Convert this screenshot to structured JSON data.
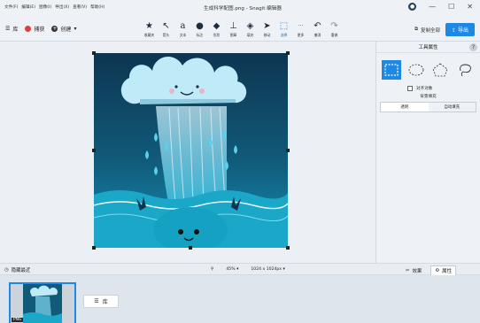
{
  "window": {
    "title": "生成科学配图.png - Snagit 编辑器",
    "menu": [
      "文件(F)",
      "编辑(E)",
      "图像(I)",
      "导出(X)",
      "查看(V)",
      "帮助(H)"
    ],
    "controls": [
      "—",
      "☐",
      "✕"
    ]
  },
  "toolbar": {
    "library": "库",
    "capture": "捕获",
    "create": "创建",
    "create_caret": "▾",
    "tools": [
      {
        "icon": "star-icon",
        "label": "收藏夹"
      },
      {
        "icon": "arrow-icon",
        "label": "箭头"
      },
      {
        "icon": "text-icon",
        "label": "文本"
      },
      {
        "icon": "callout-icon",
        "label": "标注"
      },
      {
        "icon": "shape-icon",
        "label": "形状"
      },
      {
        "icon": "stamp-icon",
        "label": "图章"
      },
      {
        "icon": "fill-icon",
        "label": "填充"
      },
      {
        "icon": "move-icon",
        "label": "移动"
      },
      {
        "icon": "selection-icon",
        "label": "选择"
      },
      {
        "icon": "more-icon",
        "label": "更多"
      },
      {
        "icon": "undo-icon",
        "label": "撤消"
      },
      {
        "icon": "redo-icon",
        "label": "重做"
      }
    ],
    "copy_all": "复制全部",
    "export": "导出"
  },
  "props": {
    "title": "工具属性",
    "help": "?",
    "align_objects": "对齐对象",
    "background_fill": "背景填充",
    "fill_options": [
      "透明",
      "自动填充"
    ]
  },
  "status": {
    "hide_recent": "隐藏最近",
    "zoom": "45%",
    "dimensions": "1024 x 1024px",
    "caret": "▾",
    "effects": "效果",
    "properties": "属性"
  },
  "tray": {
    "badge": "PNG",
    "library": "库"
  },
  "colors": {
    "accent": "#1e88e5",
    "record": "#e23b3b"
  }
}
